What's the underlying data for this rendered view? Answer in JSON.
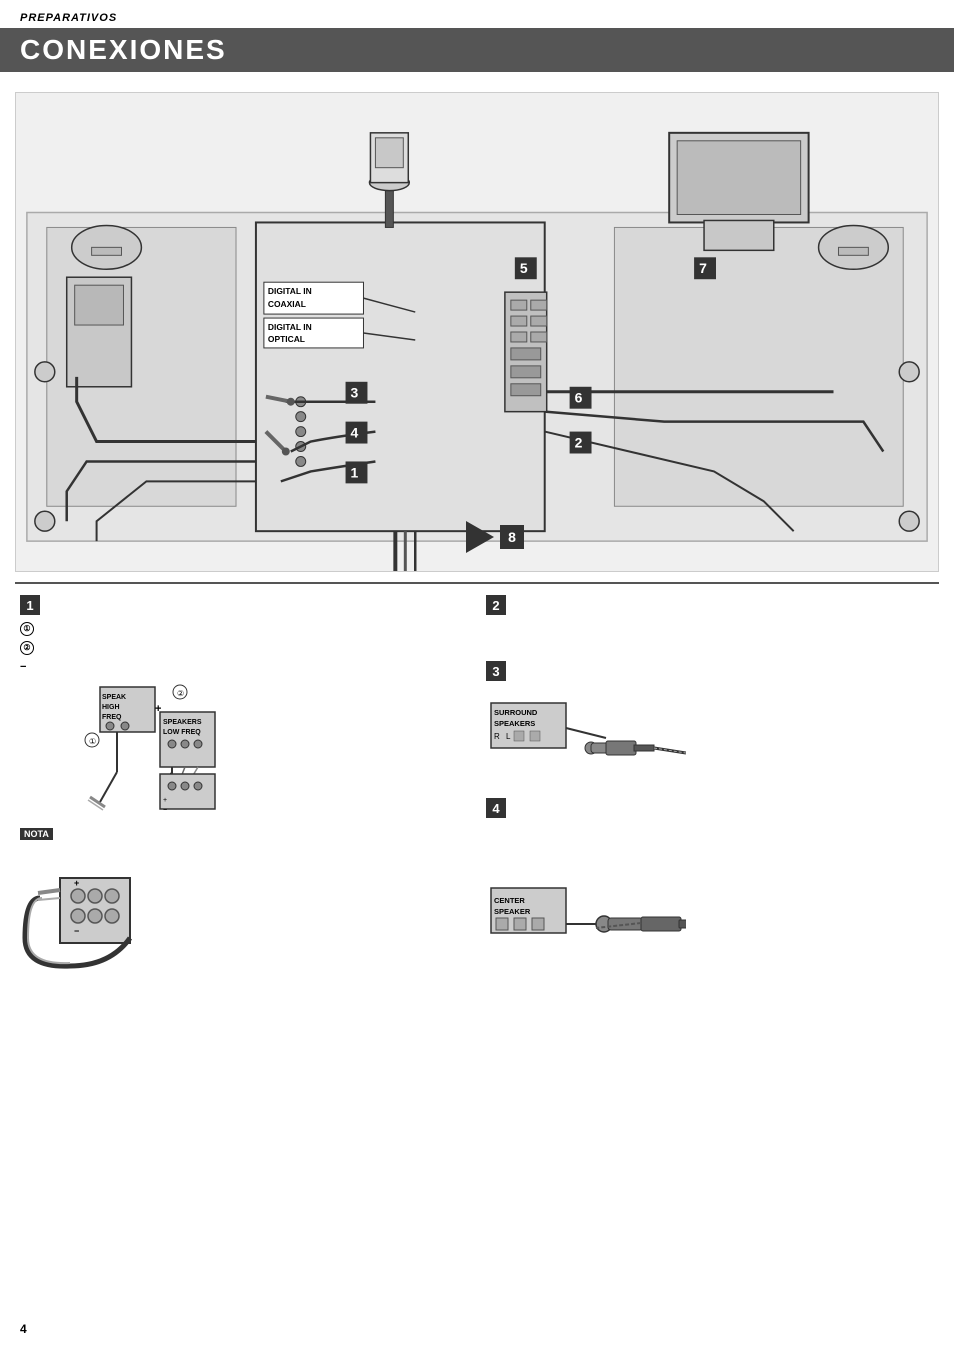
{
  "header": {
    "label": "PREPARATIVOS"
  },
  "title": "CONEXIONES",
  "diagram": {
    "badge_1": "1",
    "badge_2": "2",
    "badge_3": "3",
    "badge_4": "4",
    "badge_5": "5",
    "badge_6": "6",
    "badge_7": "7",
    "badge_8": "8",
    "digital_in_coaxial": "DIGITAL IN COAXIAL",
    "digital_in_optical": "DIGITAL IN OPTICAL"
  },
  "sections": {
    "s1": {
      "badge": "1",
      "circle1": "①",
      "circle2": "②",
      "plus": "+",
      "minus": "−",
      "label1": "SPEAKERS HIGH FREQ",
      "label2": "SPEAKERS LOW FREQ"
    },
    "s2": {
      "badge": "2"
    },
    "s3": {
      "badge": "3",
      "label": "SURROUND SPEAKERS"
    },
    "s4": {
      "badge": "4",
      "label": "CENTER SPEAKER"
    },
    "nota": "NOTA"
  },
  "page_number": "4"
}
